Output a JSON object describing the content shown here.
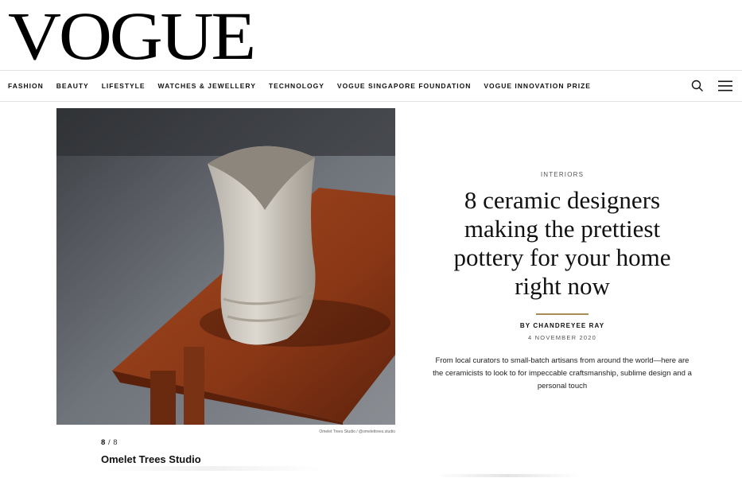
{
  "brand": {
    "logo_text": "VOGUE"
  },
  "nav": {
    "items": [
      "FASHION",
      "BEAUTY",
      "LIFESTYLE",
      "WATCHES & JEWELLERY",
      "TECHNOLOGY",
      "VOGUE SINGAPORE FOUNDATION",
      "VOGUE INNOVATION PRIZE"
    ],
    "icons": [
      "search-icon",
      "hamburger-menu-icon"
    ]
  },
  "gallery": {
    "credit": "Omelet Trees Studio / @omelettrees.studio",
    "current": "8",
    "separator": "/",
    "total": "8",
    "caption": "Omelet Trees Studio"
  },
  "article": {
    "category": "INTERIORS",
    "headline": "8 ceramic designers making the prettiest pottery for your home right now",
    "byline": "BY CHANDREYEE RAY",
    "date": "4 NOVEMBER 2020",
    "dek": "From local curators to small-batch artisans from around the world—here are the ceramicists to look to for impeccable craftsmanship, sublime design and a personal touch"
  },
  "colors": {
    "accent_rule": "#a68b55",
    "wood": "#8b3a1a",
    "ceramic": "#cfcbc2"
  }
}
